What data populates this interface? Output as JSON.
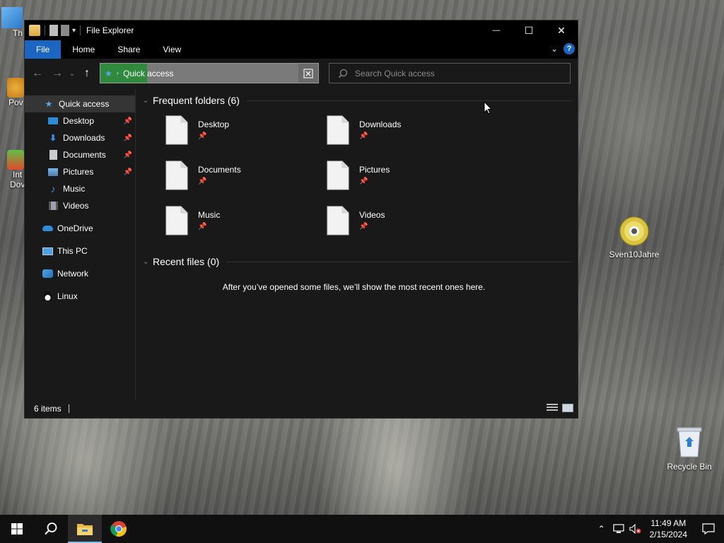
{
  "desktop": {
    "edge_labels": [
      "Th",
      "Pov",
      "Int",
      "Dov"
    ],
    "icons": [
      {
        "label": "Sven10Jahre",
        "icon": "dvd-disc-icon"
      },
      {
        "label": "Recycle Bin",
        "icon": "recycle-bin-icon"
      }
    ]
  },
  "window": {
    "title": "File Explorer",
    "controls": {
      "minimize": "—",
      "maximize": "☐",
      "close": "✕"
    }
  },
  "ribbon": {
    "tabs": [
      {
        "label": "File",
        "active": true
      },
      {
        "label": "Home"
      },
      {
        "label": "Share"
      },
      {
        "label": "View"
      }
    ],
    "help": "?"
  },
  "address": {
    "path": "Quick access",
    "search_placeholder": "Search Quick access"
  },
  "navpane": {
    "quick_access": "Quick access",
    "pinned": [
      {
        "label": "Desktop",
        "icon": "desktop-icon",
        "pinned": true
      },
      {
        "label": "Downloads",
        "icon": "downloads-icon",
        "pinned": true
      },
      {
        "label": "Documents",
        "icon": "documents-icon",
        "pinned": true
      },
      {
        "label": "Pictures",
        "icon": "pictures-icon",
        "pinned": true
      },
      {
        "label": "Music",
        "icon": "music-icon",
        "pinned": false
      },
      {
        "label": "Videos",
        "icon": "videos-icon",
        "pinned": false
      }
    ],
    "onedrive": "OneDrive",
    "this_pc": "This PC",
    "network": "Network",
    "linux": "Linux"
  },
  "content": {
    "frequent_header": "Frequent folders (6)",
    "folders": [
      {
        "name": "Desktop"
      },
      {
        "name": "Downloads"
      },
      {
        "name": "Documents"
      },
      {
        "name": "Pictures"
      },
      {
        "name": "Music"
      },
      {
        "name": "Videos"
      }
    ],
    "recent_header": "Recent files (0)",
    "recent_empty": "After you’ve opened some files, we’ll show the most recent ones here."
  },
  "status": {
    "items": "6 items"
  },
  "taskbar": {
    "clock_time": "11:49 AM",
    "clock_date": "2/15/2024"
  },
  "colors": {
    "accent": "#1a66c2",
    "window_bg": "#191919",
    "titlebar_bg": "#000000",
    "address_progress": "#2f8a3e"
  }
}
